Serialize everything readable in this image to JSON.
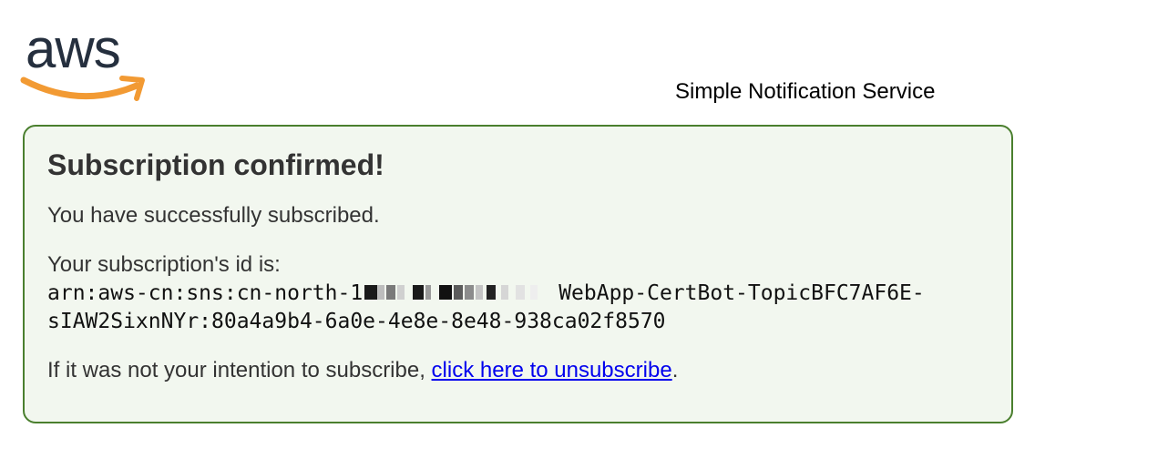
{
  "header": {
    "logo_text": "aws",
    "logo_icon": "aws-smile-arrow-icon",
    "service_name": "Simple Notification Service"
  },
  "colors": {
    "logo_text": "#252f3e",
    "logo_smile": "#f29a33",
    "panel_border": "#4a7f2e",
    "panel_background": "#f2f7ef",
    "link": "#0000ee"
  },
  "confirmation": {
    "title": "Subscription confirmed!",
    "success_message": "You have successfully subscribed.",
    "id_label": "Your subscription's id is:",
    "arn_prefix": "arn:aws-cn:sns:cn-north-1",
    "arn_redacted_icon": "redacted-account-id",
    "arn_suffix_line1": "WebApp-CertBot-TopicBFC7AF6E-",
    "arn_line2": "sIAW2SixnNYr:80a4a9b4-6a0e-4e8e-8e48-938ca02f8570",
    "unsubscribe_prefix": "If it was not your intention to subscribe, ",
    "unsubscribe_link": "click here to unsubscribe",
    "unsubscribe_suffix": "."
  }
}
